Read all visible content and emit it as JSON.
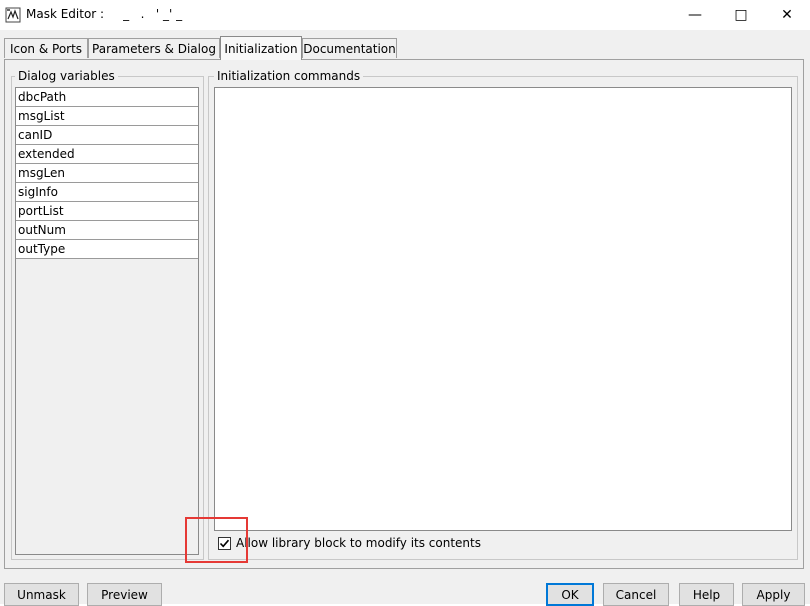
{
  "window": {
    "title": "Mask Editor :     _   .   ' _' _",
    "minimize": "—",
    "maximize": "□",
    "close": "✕"
  },
  "tabs": [
    {
      "label": "Icon & Ports"
    },
    {
      "label": "Parameters & Dialog"
    },
    {
      "label": "Initialization"
    },
    {
      "label": "Documentation"
    }
  ],
  "dialog_variables": {
    "label": "Dialog variables",
    "items": [
      "dbcPath",
      "msgList",
      "canID",
      "extended",
      "msgLen",
      "sigInfo",
      "portList",
      "outNum",
      "outType"
    ]
  },
  "initialization": {
    "label": "Initialization commands",
    "commands": ""
  },
  "allow_library": {
    "label": "Allow library block to modify its contents",
    "checked": true
  },
  "buttons": {
    "unmask": "Unmask",
    "preview": "Preview",
    "ok": "OK",
    "cancel": "Cancel",
    "help": "Help",
    "apply": "Apply"
  },
  "icons": {
    "app": "mask-editor-icon",
    "check": "check-icon"
  }
}
